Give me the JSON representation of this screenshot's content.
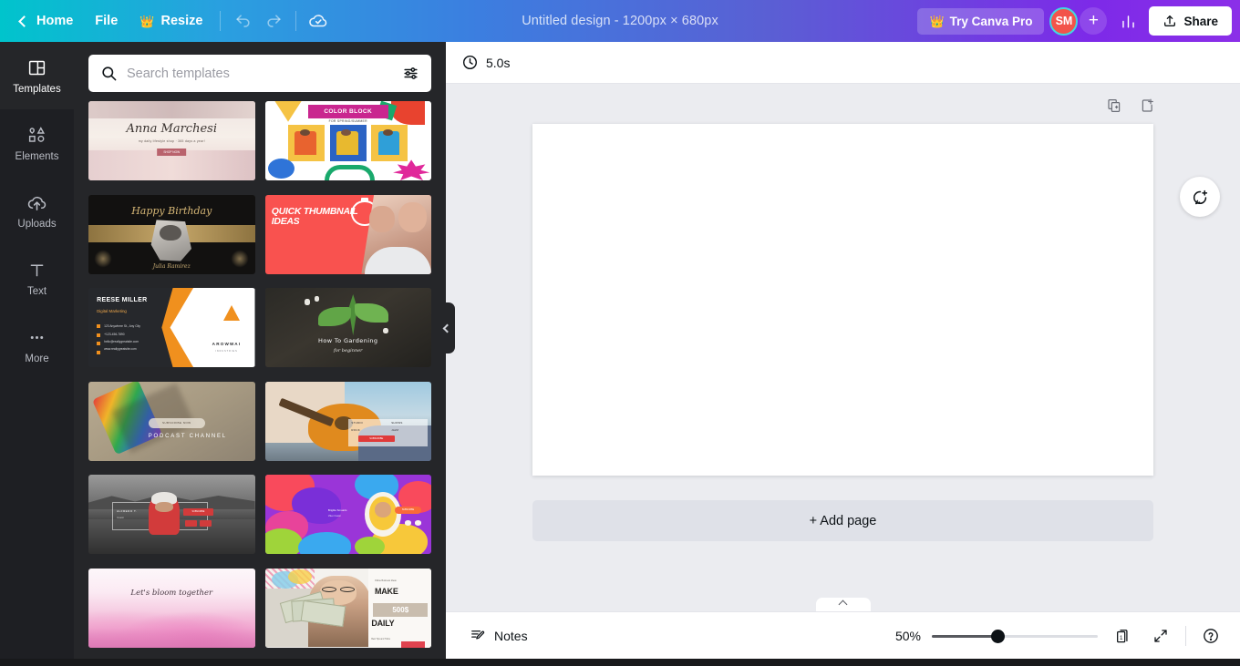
{
  "header": {
    "back_icon": "chevron-left-icon",
    "home_label": "Home",
    "file_label": "File",
    "resize_label": "Resize",
    "resize_crown": "👑",
    "undo_icon": "undo-icon",
    "redo_icon": "redo-icon",
    "cloud_icon": "cloud-saved-icon",
    "title": "Untitled design - 1200px × 680px",
    "pro_label": "Try Canva Pro",
    "pro_crown": "👑",
    "avatar_initials": "SM",
    "add_collaborator": "+",
    "analytics_icon": "analytics-icon",
    "share_label": "Share",
    "share_icon": "upload-icon"
  },
  "sidebar": {
    "items": [
      {
        "label": "Templates",
        "icon": "templates-icon",
        "active": true
      },
      {
        "label": "Elements",
        "icon": "elements-icon",
        "active": false
      },
      {
        "label": "Uploads",
        "icon": "uploads-icon",
        "active": false
      },
      {
        "label": "Text",
        "icon": "text-icon",
        "active": false
      },
      {
        "label": "More",
        "icon": "more-icon",
        "active": false
      }
    ]
  },
  "panel": {
    "search_placeholder": "Search templates",
    "search_value": "",
    "search_icon": "search-icon",
    "filter_icon": "filter-icon",
    "collapse_icon": "chevron-left-icon",
    "templates": [
      {
        "id": "anna-marchesi",
        "name": "Anna Marchesi floral banner",
        "title": "Anna Marchesi",
        "subtitle": "my daily lifestyle shop · 365 days a year!",
        "button": "SHOP NOW"
      },
      {
        "id": "color-block",
        "name": "Color Block fashion banner",
        "title": "COLOR BLOCK",
        "subtitle": "FOR SPRING/SUMMER"
      },
      {
        "id": "happy-birthday",
        "name": "Happy Birthday gold banner",
        "title": "Happy Birthday",
        "subtitle": "Julia Ramirez"
      },
      {
        "id": "quick-thumbnail",
        "name": "Quick Thumbnail Ideas banner",
        "title": "QUICK THUMBNAIL IDEAS"
      },
      {
        "id": "reese-miller",
        "name": "Reese Miller business card",
        "title": "REESE MILLER",
        "subtitle": "Digital Marketing",
        "brand": "AROWWAI",
        "brand_sub": "INDUSTRIES",
        "contacts": [
          "123 Anywhere St., Any City",
          "+123-456-7890",
          "hello@reallygreatsite.com",
          "www.reallygreatsite.com"
        ]
      },
      {
        "id": "how-to-gardening",
        "name": "How To Gardening banner",
        "title": "How To Gardening",
        "subtitle": "for beginner"
      },
      {
        "id": "podcast-channel",
        "name": "Podcast Channel skateboard banner",
        "title": "PODCAST CHANNEL",
        "button": "SUBSCRIBE NOW"
      },
      {
        "id": "guitar-studio",
        "name": "Guitar studio music banner",
        "tags": [
          "STUDIO",
          "SHOWS",
          "ROCK",
          "JAZZ"
        ],
        "button": "SUBSCRIBE"
      },
      {
        "id": "alfredo-lake",
        "name": "Alfredo T lake channel banner",
        "title": "ALFREDO T.",
        "subtitle": "Creator",
        "button": "SUBSCRIBE"
      },
      {
        "id": "colorful-blob",
        "name": "Colorful blob profile banner",
        "title": "Brigitte Smuarts",
        "subtitle": "Video Creator",
        "button": "SUBSCRIBE"
      },
      {
        "id": "lets-bloom",
        "name": "Let's bloom together floral banner",
        "title": "Let's bloom together"
      },
      {
        "id": "make-500-daily",
        "name": "Make 500$ Daily business banner",
        "title_1": "MAKE",
        "title_2": "500$",
        "title_3": "DAILY",
        "eyebrow": "Online Business Ideas",
        "footer": "Best Tips and Tricks"
      }
    ]
  },
  "editor": {
    "timer_label": "5.0s",
    "timer_icon": "clock-icon",
    "duplicate_page_icon": "duplicate-page-icon",
    "add_page_icon": "add-page-icon",
    "comment_icon": "add-comment-icon",
    "add_page_label": "+ Add page"
  },
  "bottombar": {
    "notes_label": "Notes",
    "notes_icon": "notes-icon",
    "zoom_level": "50%",
    "zoom_percent": 40,
    "page_number": "1",
    "page_icon": "pages-icon",
    "fullscreen_icon": "expand-icon",
    "help_icon": "help-icon",
    "handle_icon": "chevron-up-icon"
  },
  "colors": {
    "brand_teal": "#00c4cc",
    "brand_purple": "#7d2ae8",
    "panel_dark": "#252629",
    "rail_dark": "#1e1f23",
    "canvas_bg": "#ebecf0",
    "avatar_red": "#f2544a"
  }
}
